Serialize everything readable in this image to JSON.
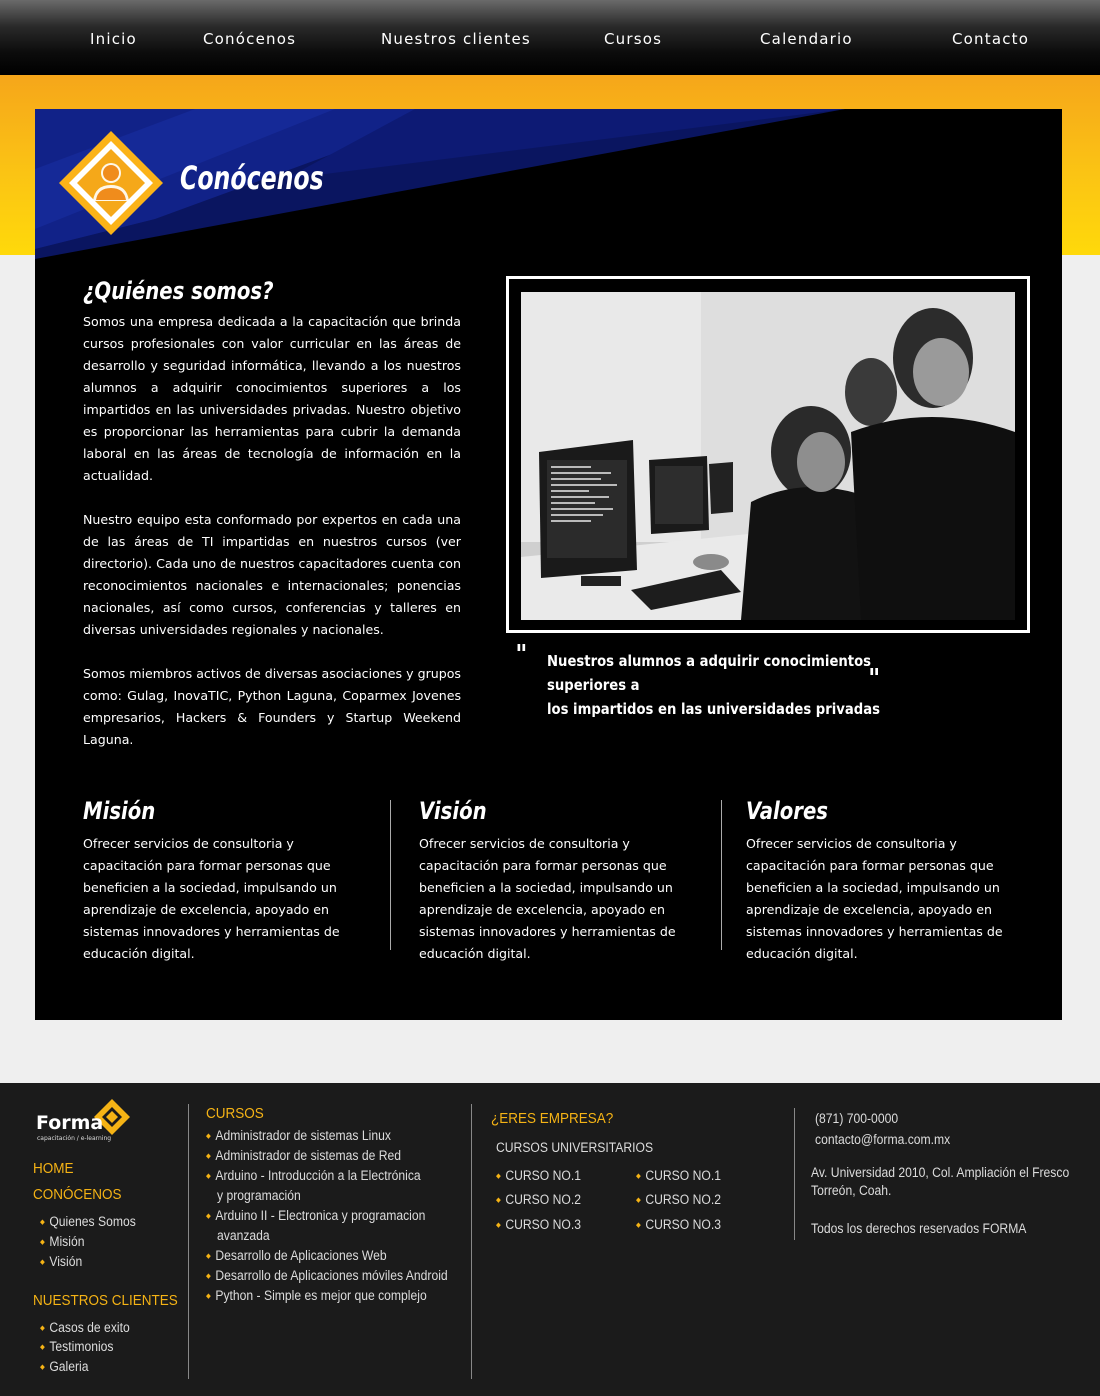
{
  "nav": {
    "items": [
      "Inicio",
      "Conócenos",
      "Nuestros clientes",
      "Cursos",
      "Calendario",
      "Contacto"
    ]
  },
  "header": {
    "title": "Conócenos"
  },
  "about": {
    "title": "¿Quiénes somos?",
    "paragraphs": [
      "Somos una empresa dedicada a la capacitación que brinda cursos profesionales con valor curricular en las áreas de desarrollo y seguridad informática, llevando a los nuestros alumnos a adquirir conocimientos superiores a los impartidos en las universidades privadas. Nuestro objetivo es proporcionar las herramientas para cubrir la demanda laboral en las áreas de tecnología de información en la actualidad.",
      "Nuestro equipo esta conformado por expertos en cada una de las áreas de TI impartidas en nuestros cursos (ver directorio). Cada uno de nuestros capacitadores cuenta con reconocimientos nacionales e internacionales; ponencias nacionales, así como cursos, conferencias y talleres en diversas universidades regionales y nacionales.",
      "Somos miembros activos de diversas asociaciones y grupos como: Gulag, InovaTIC, Python Laguna, Coparmex Jovenes empresarios, Hackers & Founders y Startup Weekend Laguna."
    ]
  },
  "quote": {
    "line1": "Nuestros alumnos a adquirir conocimientos superiores a",
    "line2": "los impartidos en las universidades privadas"
  },
  "columns": [
    {
      "title": "Misión",
      "text": "Ofrecer servicios de consultoria y capacitación para formar personas que beneficien a la sociedad, impulsando un aprendizaje de excelencia, apoyado en sistemas innovadores y herramientas de educación digital."
    },
    {
      "title": "Visión",
      "text": "Ofrecer servicios de consultoria y capacitación para formar personas que beneficien a la sociedad, impulsando un aprendizaje de excelencia, apoyado en sistemas innovadores y herramientas de educación digital."
    },
    {
      "title": "Valores",
      "text": "Ofrecer servicios de consultoria y capacitación para formar personas que beneficien a la sociedad, impulsando un aprendizaje de excelencia, apoyado en sistemas innovadores y herramientas de educación digital."
    }
  ],
  "footer": {
    "logo_text": "Forma",
    "logo_tagline": "capacitación / e-learning",
    "home": "HOME",
    "conocenos": "CONÓCENOS",
    "conocenos_items": [
      "Quienes Somos",
      "Misión",
      "Visión"
    ],
    "clientes": "NUESTROS CLIENTES",
    "clientes_items": [
      "Casos de exito",
      "Testimonios",
      "Galeria"
    ],
    "cursos_title": "CURSOS",
    "cursos_items": [
      "Administrador de sistemas Linux",
      "Administrador de sistemas de Red",
      "Arduino - Introducción a la Electrónica",
      "y programación",
      "Arduino II - Electronica y programacion",
      "avanzada",
      "Desarrollo de Aplicaciones Web",
      "Desarrollo de Aplicaciones móviles Android",
      "Python - Simple es mejor que complejo"
    ],
    "empresa_title": "¿ERES EMPRESA?",
    "universitarios_title": "CURSOS UNIVERSITARIOS",
    "cursos_left": [
      "CURSO NO.1",
      "CURSO NO.2",
      "CURSO NO.3"
    ],
    "cursos_right": [
      "CURSO NO.1",
      "CURSO NO.2",
      "CURSO NO.3"
    ],
    "phone": "(871) 700-0000",
    "email": "contacto@forma.com.mx",
    "address1": "Av. Universidad 2010, Col. Ampliación el Fresco",
    "address2": "Torreón, Coah.",
    "rights": "Todos los derechos reservados FORMA"
  },
  "colors": {
    "accent": "#f5b315",
    "nav_bg": "#000000",
    "panel_bg": "#000000",
    "header_blue": "#0b1a6e",
    "footer_bg": "#1b1b1b"
  }
}
